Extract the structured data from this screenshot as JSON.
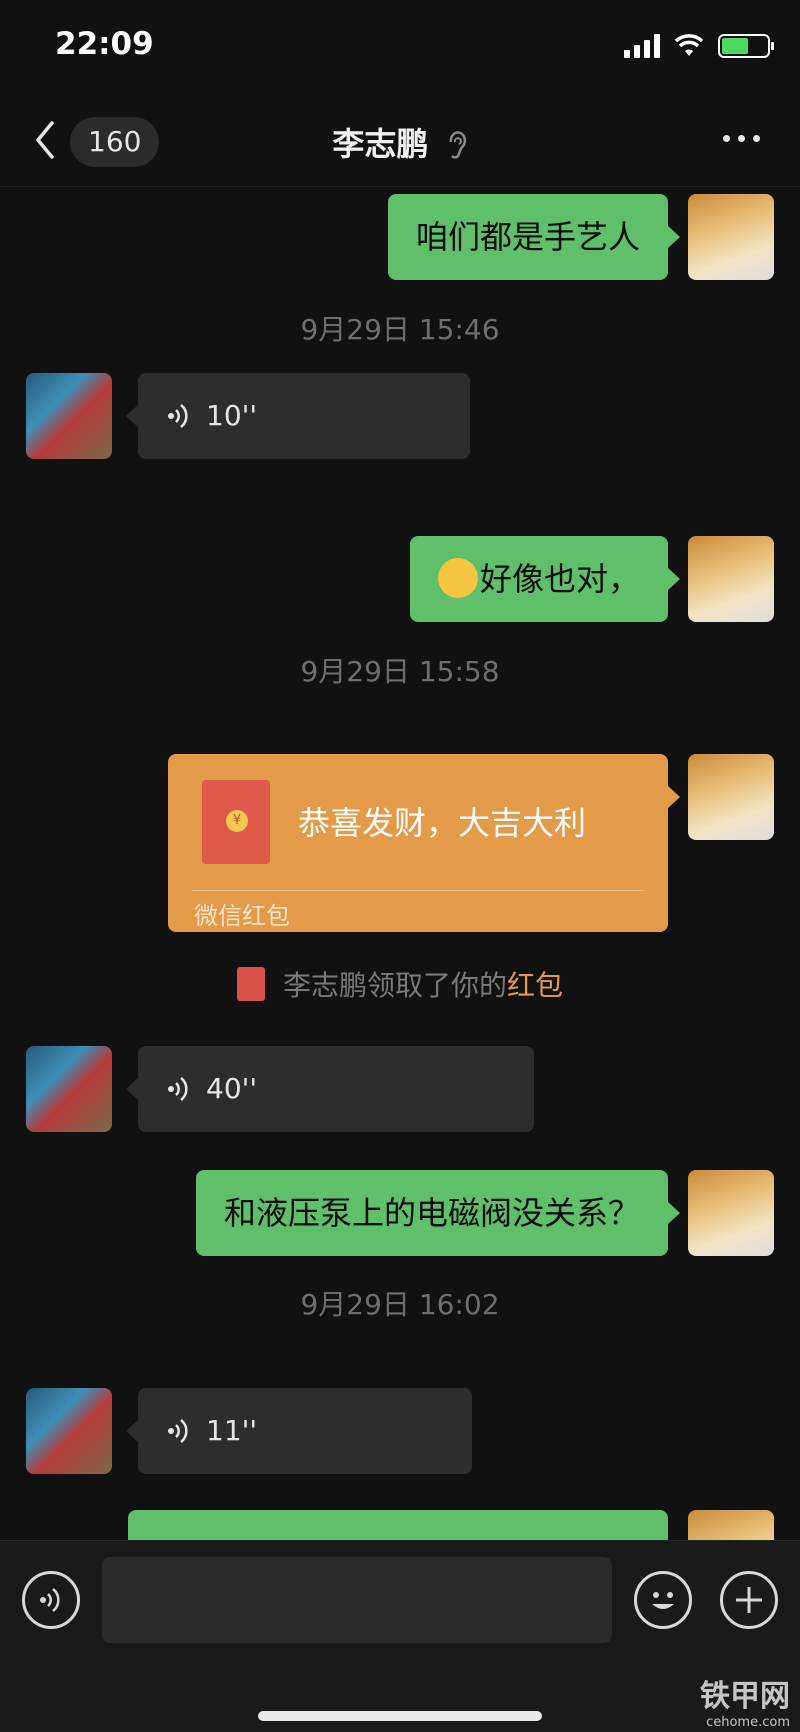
{
  "status_bar": {
    "time": "22:09"
  },
  "nav": {
    "unread_count": "160",
    "title": "李志鹏"
  },
  "messages": [
    {
      "type": "text",
      "side": "me",
      "text": "咱们都是手艺人"
    },
    {
      "type": "time",
      "text": "9月29日 15:46"
    },
    {
      "type": "voice",
      "side": "them",
      "duration": "10''"
    },
    {
      "type": "text",
      "side": "me",
      "emoji": "hush-emoji-icon",
      "text": "好像也对，"
    },
    {
      "type": "time",
      "text": "9月29日 15:58"
    },
    {
      "type": "red_packet",
      "side": "me",
      "title": "恭喜发财，大吉大利",
      "source": "微信红包"
    },
    {
      "type": "system",
      "text": "李志鹏领取了你的",
      "link": "红包"
    },
    {
      "type": "voice",
      "side": "them",
      "duration": "40''"
    },
    {
      "type": "text",
      "side": "me",
      "text": "和液压泵上的电磁阀没关系？"
    },
    {
      "type": "time",
      "text": "9月29日 16:02"
    },
    {
      "type": "voice",
      "side": "them",
      "duration": "11''"
    }
  ],
  "watermark": {
    "main": "铁甲网",
    "sub": "cehome.com"
  },
  "colors": {
    "my_bubble": "#5fbf6a",
    "their_bubble": "#2d2d2d",
    "red_packet": "#e39a49",
    "background": "#111111"
  }
}
